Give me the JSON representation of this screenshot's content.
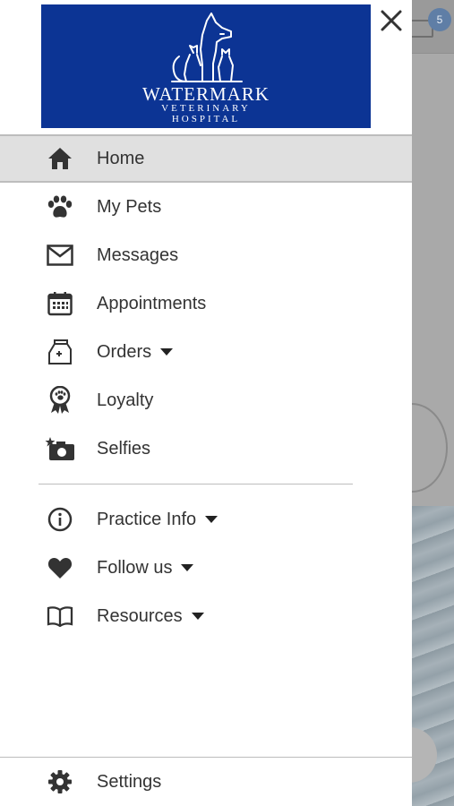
{
  "background": {
    "badge_count": "5"
  },
  "logo": {
    "line1": "WATERMARK",
    "line2": "VETERINARY",
    "line3": "HOSPITAL"
  },
  "menu": {
    "items": [
      {
        "label": "Home",
        "icon": "home-icon",
        "active": true
      },
      {
        "label": "My Pets",
        "icon": "paw-icon"
      },
      {
        "label": "Messages",
        "icon": "envelope-icon"
      },
      {
        "label": "Appointments",
        "icon": "calendar-icon"
      },
      {
        "label": "Orders",
        "icon": "food-bag-icon",
        "has_dropdown": true
      },
      {
        "label": "Loyalty",
        "icon": "award-ribbon-icon"
      },
      {
        "label": "Selfies",
        "icon": "camera-star-icon"
      }
    ],
    "secondary": [
      {
        "label": "Practice Info",
        "icon": "info-circle-icon",
        "has_dropdown": true
      },
      {
        "label": "Follow us",
        "icon": "heart-icon",
        "has_dropdown": true
      },
      {
        "label": "Resources",
        "icon": "open-book-icon",
        "has_dropdown": true
      }
    ],
    "settings": {
      "label": "Settings",
      "icon": "gear-icon"
    }
  },
  "colors": {
    "brand_blue": "#0c3494",
    "active_bg": "#e0e0e0",
    "text": "#333333"
  }
}
